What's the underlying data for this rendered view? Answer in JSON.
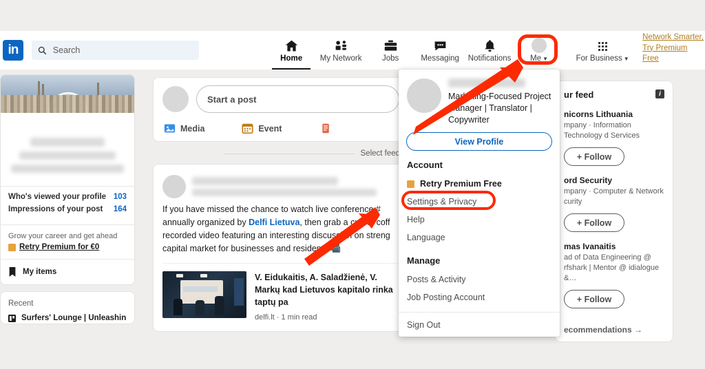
{
  "nav": {
    "logo": "in",
    "search_placeholder": "Search",
    "items": [
      {
        "label": "Home",
        "icon": "home-icon",
        "active": true
      },
      {
        "label": "My Network",
        "icon": "people-icon",
        "active": false
      },
      {
        "label": "Jobs",
        "icon": "briefcase-icon",
        "active": false
      },
      {
        "label": "Messaging",
        "icon": "message-icon",
        "active": false
      },
      {
        "label": "Notifications",
        "icon": "bell-icon",
        "active": false
      },
      {
        "label": "Me",
        "icon": "avatar-icon",
        "active": false
      }
    ],
    "for_business": "For Business",
    "premium_line1": "Network Smarter,",
    "premium_line2": "Try Premium Free",
    "premium_color": "#b07d1e"
  },
  "left": {
    "stats": [
      {
        "label": "Who's viewed your profile",
        "value": "103"
      },
      {
        "label": "Impressions of your post",
        "value": "164"
      }
    ],
    "promo_top": "Grow your career and get ahead",
    "promo_link": "Retry Premium for €0",
    "my_items": "My items",
    "recent_title": "Recent",
    "recent_item": "Surfers' Lounge | Unleashin"
  },
  "center": {
    "composer_placeholder": "Start a post",
    "actions": [
      {
        "label": "Media",
        "icon": "image-icon"
      },
      {
        "label": "Event",
        "icon": "calendar-icon"
      },
      {
        "label": "",
        "icon": "article-icon"
      }
    ],
    "feed_selector": "Select feed v",
    "post_text_1": "If you have missed the chance to watch live conference #",
    "post_link": "Delfi Lietuva",
    "post_text_2": "annually organized by ",
    "post_text_3": ", then grab a cup of coff",
    "post_text_4": "recorded video featuring an interesting discussion on streng",
    "post_text_5": "capital market for businesses and residents",
    "article_title": "V. Eidukaitis, A. Saladžienė, V. Markų kad Lietuvos kapitalo rinka taptų pa",
    "article_meta": "delfi.lt · 1 min read"
  },
  "right": {
    "feed_title": "ur feed",
    "info_icon": "info-icon",
    "suggestions": [
      {
        "name": "nicorns Lithuania",
        "sub": "mpany · Information Technology d Services",
        "follow": "+ Follow"
      },
      {
        "name": "ord Security",
        "sub": "mpany · Computer & Network curity",
        "follow": "+ Follow"
      },
      {
        "name": "mas Ivanaitis",
        "sub": "ad of Data Engineering @ rfshark | Mentor @ idialogue &…",
        "follow": "+ Follow"
      }
    ],
    "footer": "ecommendations →"
  },
  "dropdown": {
    "headline": "Marketing-Focused Project Manager | Translator | Copywriter",
    "view_profile": "View Profile",
    "account_title": "Account",
    "account_items": [
      {
        "label": "Retry Premium Free",
        "icon": "gold-square-icon",
        "bold": true
      },
      {
        "label": "Settings & Privacy",
        "icon": "",
        "bold": false
      },
      {
        "label": "Help",
        "icon": "",
        "bold": false
      },
      {
        "label": "Language",
        "icon": "",
        "bold": false
      }
    ],
    "manage_title": "Manage",
    "manage_items": [
      {
        "label": "Posts & Activity"
      },
      {
        "label": "Job Posting Account"
      }
    ],
    "sign_out": "Sign Out"
  },
  "annotations": {
    "highlight_color": "#fc2a00",
    "ring_me": "Me",
    "ring_settings": "Settings & Privacy"
  }
}
